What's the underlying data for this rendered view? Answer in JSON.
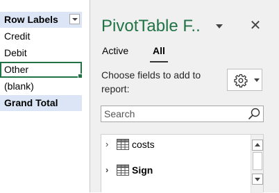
{
  "pivot": {
    "header": "Row Labels",
    "rows": [
      "Credit",
      "Debit",
      "Other",
      "(blank)"
    ],
    "selected_row": "Other",
    "total": "Grand Total"
  },
  "pane": {
    "title": "PivotTable F..",
    "close": "✕",
    "tabs": [
      {
        "label": "Active",
        "selected": false
      },
      {
        "label": "All",
        "selected": true
      }
    ],
    "instruction": "Choose fields to add to report:",
    "search_placeholder": "Search",
    "fields": [
      {
        "name": "costs",
        "bold": false
      },
      {
        "name": "Sign",
        "bold": true
      }
    ]
  },
  "colors": {
    "accent": "#217346",
    "header_fill": "#dbe5f5",
    "pane_bg": "#f0f0f0"
  },
  "icons": [
    "dropdown-icon",
    "menu-caret-icon",
    "close-icon",
    "gear-icon",
    "search-icon",
    "chevron-right-icon",
    "table-icon"
  ]
}
